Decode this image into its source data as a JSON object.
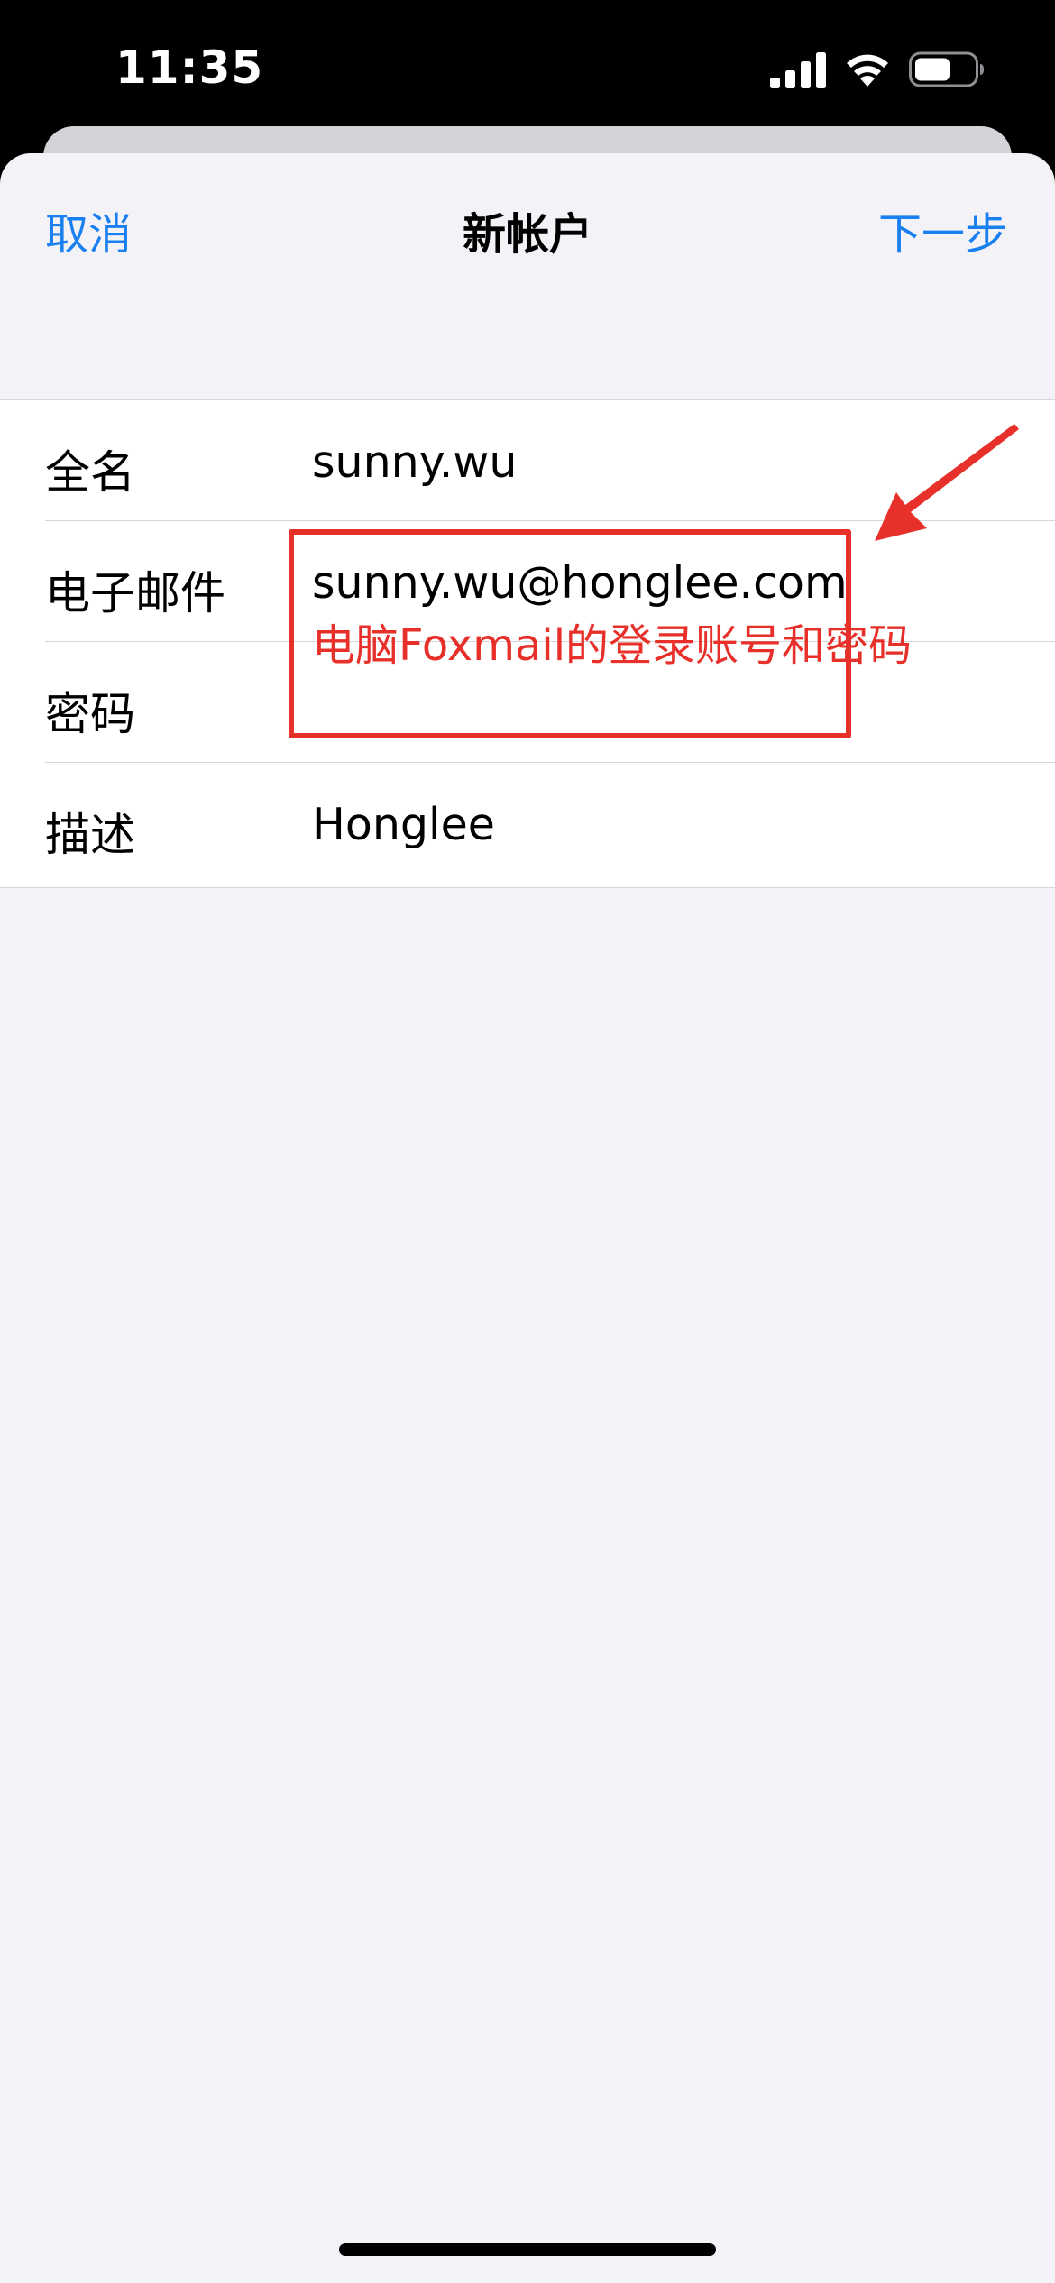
{
  "status_bar": {
    "time": "11:35",
    "icons": [
      "signal-icon",
      "wifi-icon",
      "battery-icon"
    ]
  },
  "nav": {
    "cancel_label": "取消",
    "title": "新帐户",
    "next_label": "下一步"
  },
  "form": {
    "rows": [
      {
        "label": "全名",
        "value": "sunny.wu"
      },
      {
        "label": "电子邮件",
        "value": "sunny.wu@honglee.com"
      },
      {
        "label": "密码",
        "value": ""
      },
      {
        "label": "描述",
        "value": "Honglee"
      }
    ]
  },
  "annotation": {
    "text": "电脑Foxmail的登录账号和密码",
    "color": "#e8302a"
  },
  "colors": {
    "accent": "#1a7ff0",
    "background": "#f2f2f7",
    "annotation": "#e8302a"
  }
}
